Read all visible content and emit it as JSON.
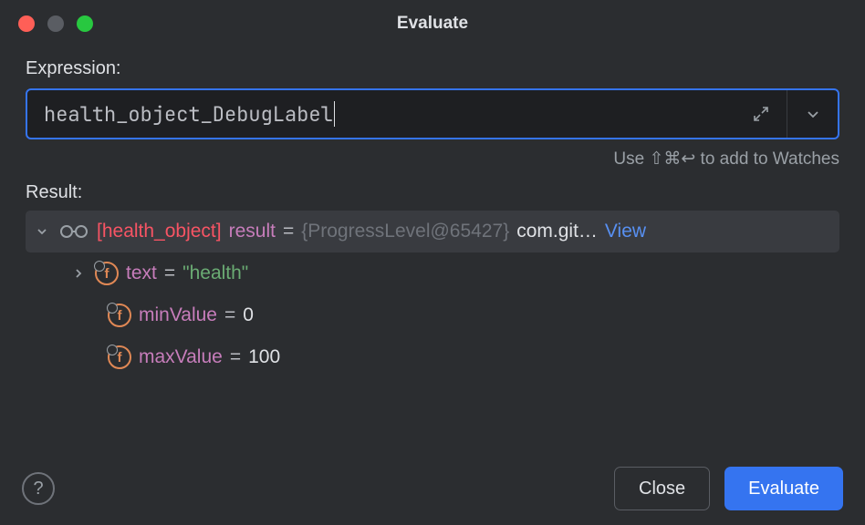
{
  "window": {
    "title": "Evaluate"
  },
  "expression": {
    "label": "Expression:",
    "value": "health_object_DebugLabel",
    "hint": "Use ⇧⌘↩ to add to Watches"
  },
  "result": {
    "label": "Result:",
    "root": {
      "tag": "[health_object]",
      "var": "result",
      "eq": "=",
      "type": "{ProgressLevel@65427}",
      "tail": "com.git…",
      "view": "View"
    },
    "fields": [
      {
        "name": "text",
        "eq": "=",
        "value": "\"health\"",
        "isString": true,
        "hasChildren": true
      },
      {
        "name": "minValue",
        "eq": "=",
        "value": "0",
        "isString": false,
        "hasChildren": false
      },
      {
        "name": "maxValue",
        "eq": "=",
        "value": "100",
        "isString": false,
        "hasChildren": false
      }
    ]
  },
  "buttons": {
    "close": "Close",
    "evaluate": "Evaluate",
    "help": "?"
  },
  "icons": {
    "field_letter": "f"
  }
}
